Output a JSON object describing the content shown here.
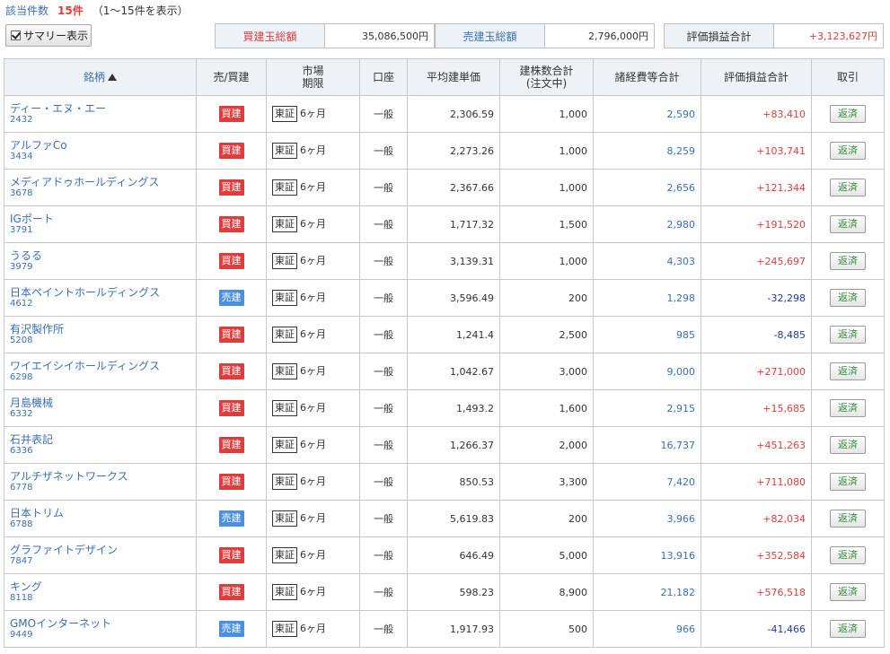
{
  "header": {
    "count_label": "該当件数",
    "count_value": "15件",
    "range_text": "（1～15件を表示）",
    "summary_toggle": "サマリー表示"
  },
  "summary": {
    "buy_total_label": "買建玉総額",
    "buy_total_value": "35,086,500円",
    "sell_total_label": "売建玉総額",
    "sell_total_value": "2,796,000円",
    "pl_total_label": "評価損益合計",
    "pl_total_value": "+3,123,627円"
  },
  "table": {
    "columns": {
      "name": "銘柄",
      "side": "売/買建",
      "market": "市場",
      "term": "期限",
      "account": "口座",
      "avg_price": "平均建単価",
      "qty": "建株数合計",
      "qty_sub": "(注文中)",
      "fees": "諸経費等合計",
      "pl": "評価損益合計",
      "action": "取引"
    },
    "market_label": "東証",
    "term_label": "6ヶ月",
    "account_label": "一般",
    "action_label": "返済",
    "rows": [
      {
        "name": "ディー・エヌ・エー",
        "code": "2432",
        "side": "買建",
        "avg_price": "2,306.59",
        "qty": "1,000",
        "fees": "2,590",
        "pl": "+83,410"
      },
      {
        "name": "アルファCo",
        "code": "3434",
        "side": "買建",
        "avg_price": "2,273.26",
        "qty": "1,000",
        "fees": "8,259",
        "pl": "+103,741"
      },
      {
        "name": "メディアドゥホールディングス",
        "code": "3678",
        "side": "買建",
        "avg_price": "2,367.66",
        "qty": "1,000",
        "fees": "2,656",
        "pl": "+121,344"
      },
      {
        "name": "IGポート",
        "code": "3791",
        "side": "買建",
        "avg_price": "1,717.32",
        "qty": "1,500",
        "fees": "2,980",
        "pl": "+191,520"
      },
      {
        "name": "うるる",
        "code": "3979",
        "side": "買建",
        "avg_price": "3,139.31",
        "qty": "1,000",
        "fees": "4,303",
        "pl": "+245,697"
      },
      {
        "name": "日本ペイントホールディングス",
        "code": "4612",
        "side": "売建",
        "avg_price": "3,596.49",
        "qty": "200",
        "fees": "1,298",
        "pl": "-32,298"
      },
      {
        "name": "有沢製作所",
        "code": "5208",
        "side": "買建",
        "avg_price": "1,241.4",
        "qty": "2,500",
        "fees": "985",
        "pl": "-8,485"
      },
      {
        "name": "ワイエイシイホールディングス",
        "code": "6298",
        "side": "買建",
        "avg_price": "1,042.67",
        "qty": "3,000",
        "fees": "9,000",
        "pl": "+271,000"
      },
      {
        "name": "月島機械",
        "code": "6332",
        "side": "買建",
        "avg_price": "1,493.2",
        "qty": "1,600",
        "fees": "2,915",
        "pl": "+15,685"
      },
      {
        "name": "石井表記",
        "code": "6336",
        "side": "買建",
        "avg_price": "1,266.37",
        "qty": "2,000",
        "fees": "16,737",
        "pl": "+451,263"
      },
      {
        "name": "アルチザネットワークス",
        "code": "6778",
        "side": "買建",
        "avg_price": "850.53",
        "qty": "3,300",
        "fees": "7,420",
        "pl": "+711,080"
      },
      {
        "name": "日本トリム",
        "code": "6788",
        "side": "売建",
        "avg_price": "5,619.83",
        "qty": "200",
        "fees": "3,966",
        "pl": "+82,034"
      },
      {
        "name": "グラファイトデザイン",
        "code": "7847",
        "side": "買建",
        "avg_price": "646.49",
        "qty": "5,000",
        "fees": "13,916",
        "pl": "+352,584"
      },
      {
        "name": "キング",
        "code": "8118",
        "side": "買建",
        "avg_price": "598.23",
        "qty": "8,900",
        "fees": "21,182",
        "pl": "+576,518"
      },
      {
        "name": "GMOインターネット",
        "code": "9449",
        "side": "売建",
        "avg_price": "1,917.93",
        "qty": "500",
        "fees": "966",
        "pl": "-41,466"
      }
    ]
  }
}
